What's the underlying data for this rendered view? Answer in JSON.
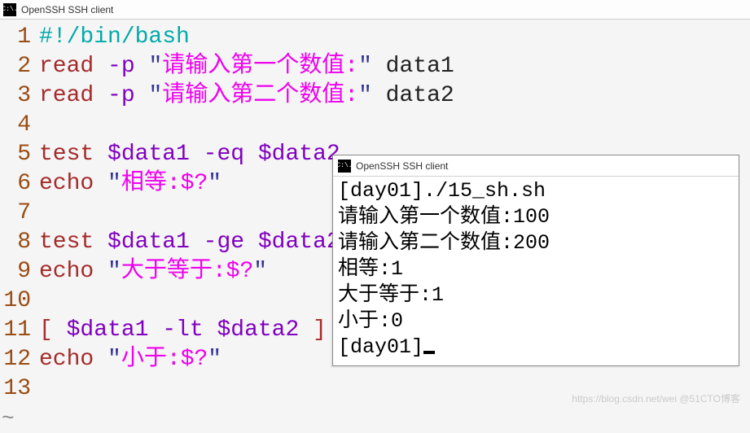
{
  "window": {
    "title": "OpenSSH SSH client",
    "icon_glyph": "C:\\."
  },
  "editor": {
    "lines": [
      {
        "n": "1",
        "tokens": [
          {
            "t": "#!/bin/bash",
            "c": "tk-cyan"
          }
        ]
      },
      {
        "n": "2",
        "tokens": [
          {
            "t": "read",
            "c": "tk-brown"
          },
          {
            "t": " -p ",
            "c": "tk-purple"
          },
          {
            "t": "\"",
            "c": "tk-quote"
          },
          {
            "t": "请输入第一个数值:",
            "c": "tk-string"
          },
          {
            "t": "\"",
            "c": "tk-quote"
          },
          {
            "t": " data1",
            "c": "tk-default"
          }
        ]
      },
      {
        "n": "3",
        "tokens": [
          {
            "t": "read",
            "c": "tk-brown"
          },
          {
            "t": " -p ",
            "c": "tk-purple"
          },
          {
            "t": "\"",
            "c": "tk-quote"
          },
          {
            "t": "请输入第二个数值:",
            "c": "tk-string"
          },
          {
            "t": "\"",
            "c": "tk-quote"
          },
          {
            "t": " data2",
            "c": "tk-default"
          }
        ]
      },
      {
        "n": "4",
        "tokens": []
      },
      {
        "n": "5",
        "tokens": [
          {
            "t": "test",
            "c": "tk-brown"
          },
          {
            "t": " ",
            "c": "tk-default"
          },
          {
            "t": "$data1",
            "c": "tk-purple"
          },
          {
            "t": " -eq ",
            "c": "tk-purple"
          },
          {
            "t": "$data2",
            "c": "tk-purple"
          }
        ]
      },
      {
        "n": "6",
        "tokens": [
          {
            "t": "echo",
            "c": "tk-brown"
          },
          {
            "t": " ",
            "c": "tk-default"
          },
          {
            "t": "\"",
            "c": "tk-quote"
          },
          {
            "t": "相等:$?",
            "c": "tk-string"
          },
          {
            "t": "\"",
            "c": "tk-quote"
          }
        ]
      },
      {
        "n": "7",
        "tokens": []
      },
      {
        "n": "8",
        "tokens": [
          {
            "t": "test",
            "c": "tk-brown"
          },
          {
            "t": " ",
            "c": "tk-default"
          },
          {
            "t": "$data1",
            "c": "tk-purple"
          },
          {
            "t": " -ge ",
            "c": "tk-purple"
          },
          {
            "t": "$data2",
            "c": "tk-purple"
          }
        ]
      },
      {
        "n": "9",
        "tokens": [
          {
            "t": "echo",
            "c": "tk-brown"
          },
          {
            "t": " ",
            "c": "tk-default"
          },
          {
            "t": "\"",
            "c": "tk-quote"
          },
          {
            "t": "大于等于:$?",
            "c": "tk-string"
          },
          {
            "t": "\"",
            "c": "tk-quote"
          }
        ]
      },
      {
        "n": "10",
        "tokens": []
      },
      {
        "n": "11",
        "tokens": [
          {
            "t": "[",
            "c": "tk-brown"
          },
          {
            "t": " ",
            "c": "tk-default"
          },
          {
            "t": "$data1",
            "c": "tk-purple"
          },
          {
            "t": " -lt ",
            "c": "tk-purple"
          },
          {
            "t": "$data2",
            "c": "tk-purple"
          },
          {
            "t": " ",
            "c": "tk-default"
          },
          {
            "t": "]",
            "c": "tk-brown"
          }
        ]
      },
      {
        "n": "12",
        "tokens": [
          {
            "t": "echo",
            "c": "tk-brown"
          },
          {
            "t": " ",
            "c": "tk-default"
          },
          {
            "t": "\"",
            "c": "tk-quote"
          },
          {
            "t": "小于:$?",
            "c": "tk-string"
          },
          {
            "t": "\"",
            "c": "tk-quote"
          }
        ]
      },
      {
        "n": "13",
        "tokens": []
      }
    ],
    "trailing_tilde": "~"
  },
  "terminal": {
    "title": "OpenSSH SSH client",
    "icon_glyph": "C:\\.",
    "lines": [
      "[day01]./15_sh.sh",
      "请输入第一个数值:100",
      "请输入第二个数值:200",
      "相等:1",
      "大于等于:1",
      "小于:0",
      "[day01]"
    ]
  },
  "watermark": "https://blog.csdn.net/wei  @51CTO博客"
}
